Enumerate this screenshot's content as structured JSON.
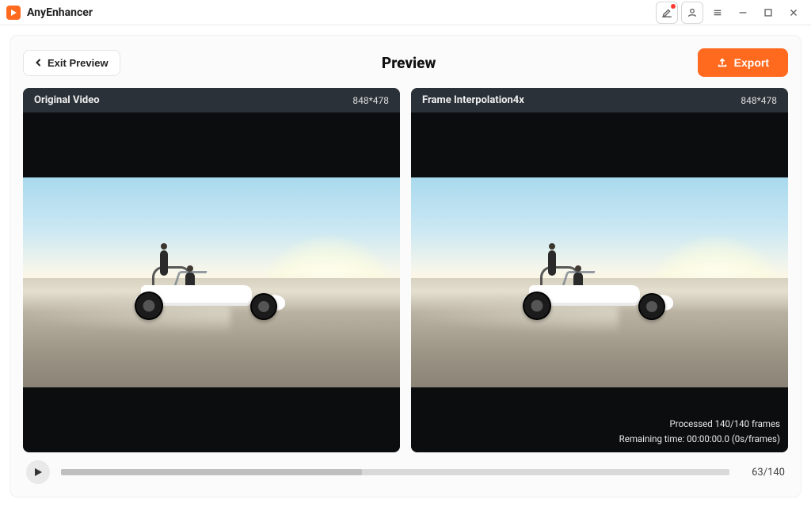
{
  "app": {
    "name": "AnyEnhancer"
  },
  "toolbar": {
    "exit_label": "Exit Preview",
    "title": "Preview",
    "export_label": "Export"
  },
  "panes": {
    "left": {
      "title": "Original Video",
      "resolution": "848*478"
    },
    "right": {
      "title": "Frame Interpolation4x",
      "resolution": "848*478",
      "stats": {
        "processed": "Processed 140/140 frames",
        "remaining": "Remaining time: 00:00:00.0 (0s/frames)"
      }
    }
  },
  "playback": {
    "current_frame": 63,
    "total_frames": 140,
    "label": "63/140",
    "progress_percent": 45
  },
  "colors": {
    "accent": "#ff6a1f"
  }
}
